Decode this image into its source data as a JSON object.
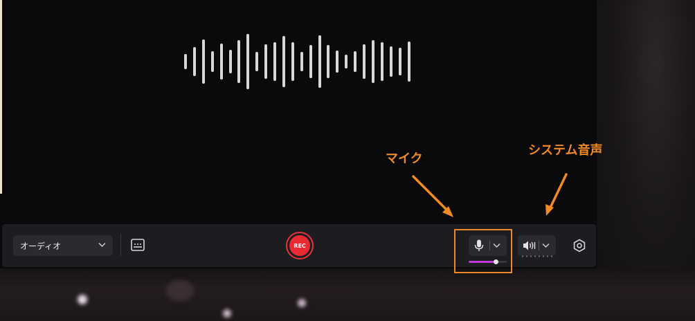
{
  "toolbar": {
    "mode_select": {
      "value": "オーディオ",
      "icon": "chevron-down-icon"
    },
    "caption_icon": "caption-icon",
    "record_button": {
      "label": "REC",
      "color": "#ea2a33"
    },
    "microphone": {
      "icon": "microphone-icon",
      "level": 0.7,
      "level_color": "#c03ad8"
    },
    "system_audio": {
      "icon": "speaker-icon"
    },
    "settings_icon": "settings-icon"
  },
  "annotations": {
    "microphone_label": "マイク",
    "system_audio_label": "システム音声",
    "color": "#f08a24"
  }
}
